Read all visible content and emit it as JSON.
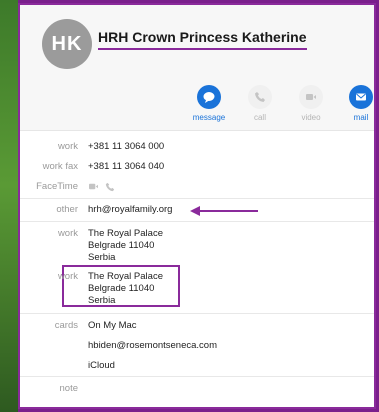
{
  "contact": {
    "initials": "HK",
    "name": "HRH Crown Princess Katherine"
  },
  "actions": [
    {
      "label": "message",
      "icon": "message-bubble-icon",
      "enabled": true
    },
    {
      "label": "call",
      "icon": "phone-icon",
      "enabled": false
    },
    {
      "label": "video",
      "icon": "video-camera-icon",
      "enabled": false
    },
    {
      "label": "mail",
      "icon": "envelope-icon",
      "enabled": true
    }
  ],
  "fields": {
    "phone_work": {
      "label": "work",
      "value": "+381 11 3064 000"
    },
    "fax_work": {
      "label": "work fax",
      "value": "+381 11 3064 040"
    },
    "facetime": {
      "label": "FaceTime"
    },
    "email_other": {
      "label": "other",
      "value": "hrh@royalfamily.org"
    },
    "address_work_1": {
      "label": "work",
      "line1": "The Royal Palace",
      "line2": "Belgrade 11040",
      "line3": "Serbia"
    },
    "address_work_2": {
      "label": "work",
      "line1": "The Royal Palace",
      "line2": "Belgrade 11040",
      "line3": "Serbia"
    },
    "cards": {
      "label": "cards",
      "items": [
        "On My Mac",
        "hbiden@rosemontseneca.com",
        "iCloud"
      ]
    },
    "note": {
      "label": "note"
    }
  },
  "colors": {
    "accent": "#1a73d9",
    "highlight": "#8a2a9b"
  }
}
